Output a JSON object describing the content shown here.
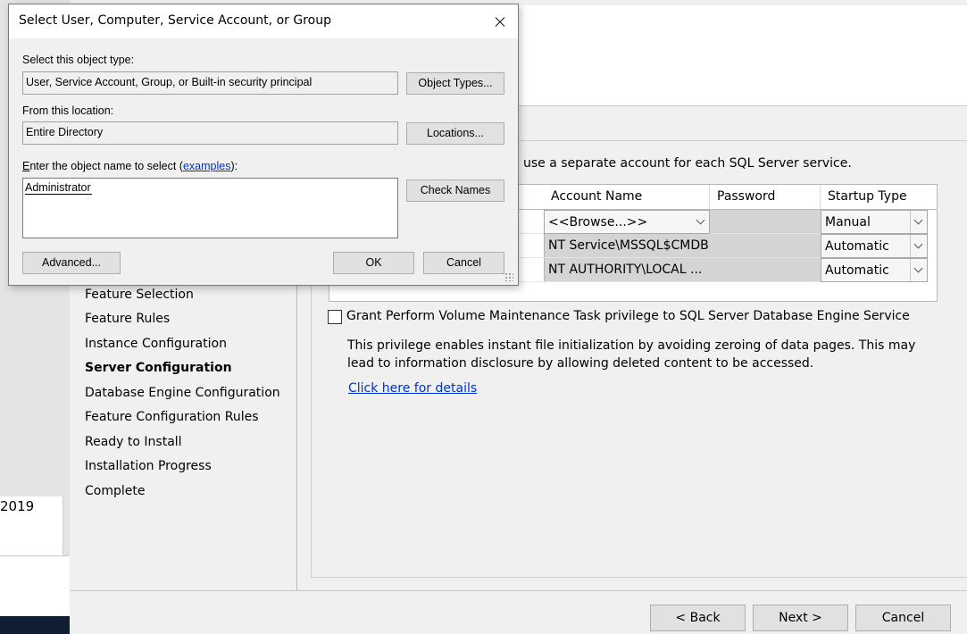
{
  "desktop": {
    "year_fragment": "2019"
  },
  "setup": {
    "nav_items": [
      "Feature Selection",
      "Feature Rules",
      "Instance Configuration",
      "Server Configuration",
      "Database Engine Configuration",
      "Feature Configuration Rules",
      "Ready to Install",
      "Installation Progress",
      "Complete"
    ],
    "active_nav": "Server Configuration",
    "hint_text": "use a separate account for each SQL Server service.",
    "grid": {
      "columns": [
        "Account Name",
        "Password",
        "Startup Type"
      ],
      "rows": [
        {
          "account": "<<Browse...>>",
          "password": "",
          "startup": "Manual"
        },
        {
          "account": "NT Service\\MSSQL$CMDB",
          "password": "",
          "startup": "Automatic"
        },
        {
          "account": "NT AUTHORITY\\LOCAL ...",
          "password": "",
          "startup": "Automatic"
        }
      ]
    },
    "grant_label": "Grant Perform Volume Maintenance Task privilege to SQL Server Database Engine Service",
    "grant_checked": false,
    "privilege_description": "This privilege enables instant file initialization by avoiding zeroing of data pages. This may lead to information disclosure by allowing deleted content to be accessed.",
    "details_link": "Click here for details",
    "buttons": {
      "back": "< Back",
      "next": "Next >",
      "cancel": "Cancel"
    }
  },
  "dialog": {
    "title": "Select User, Computer, Service Account, or Group",
    "object_type_label": "Select this object type:",
    "object_type_value": "User, Service Account, Group, or Built-in security principal",
    "object_types_button": "Object Types...",
    "location_label": "From this location:",
    "location_value": "Entire Directory",
    "locations_button": "Locations...",
    "name_label_prefix": "nter the object name to select (",
    "name_label_accel": "E",
    "name_label_link": "examples",
    "name_label_suffix": "):",
    "name_value": "Administrator",
    "check_names_button": "Check Names",
    "advanced_button": "Advanced...",
    "ok_button": "OK",
    "cancel_button": "Cancel"
  },
  "colors": {
    "link": "#0033cc",
    "dialog_bg": "#f0f0f0",
    "taskbar": "#0f1e33"
  }
}
